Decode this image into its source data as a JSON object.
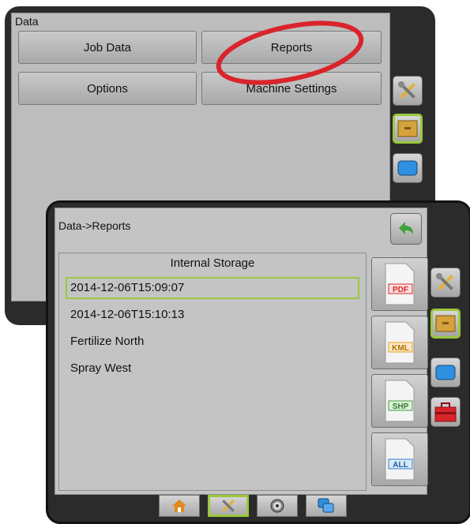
{
  "back_screen": {
    "title": "Data",
    "buttons": {
      "job_data": "Job Data",
      "reports": "Reports",
      "options": "Options",
      "machine_settings": "Machine Settings"
    }
  },
  "front_screen": {
    "title": "Data->Reports",
    "storage_label": "Internal Storage",
    "items": [
      "2014-12-06T15:09:07",
      "2014-12-06T15:10:13",
      "Fertilize North",
      "Spray West"
    ],
    "selected_index": 0,
    "file_types": [
      "PDF",
      "KML",
      "SHP",
      "ALL"
    ]
  },
  "icons": {
    "back": "back-arrow-icon",
    "tools": "tools-icon",
    "data": "file-cabinet-icon",
    "display": "display-icon",
    "toolbox": "toolbox-icon",
    "home": "home-icon",
    "guidance": "target-icon",
    "layers": "layers-icon"
  },
  "colors": {
    "highlight": "#9cc83c",
    "annotation_circle": "#d9242b",
    "pdf": "#d9242b",
    "kml": "#e7a11d",
    "shp": "#3f9e3a",
    "all": "#2e7fd1"
  }
}
